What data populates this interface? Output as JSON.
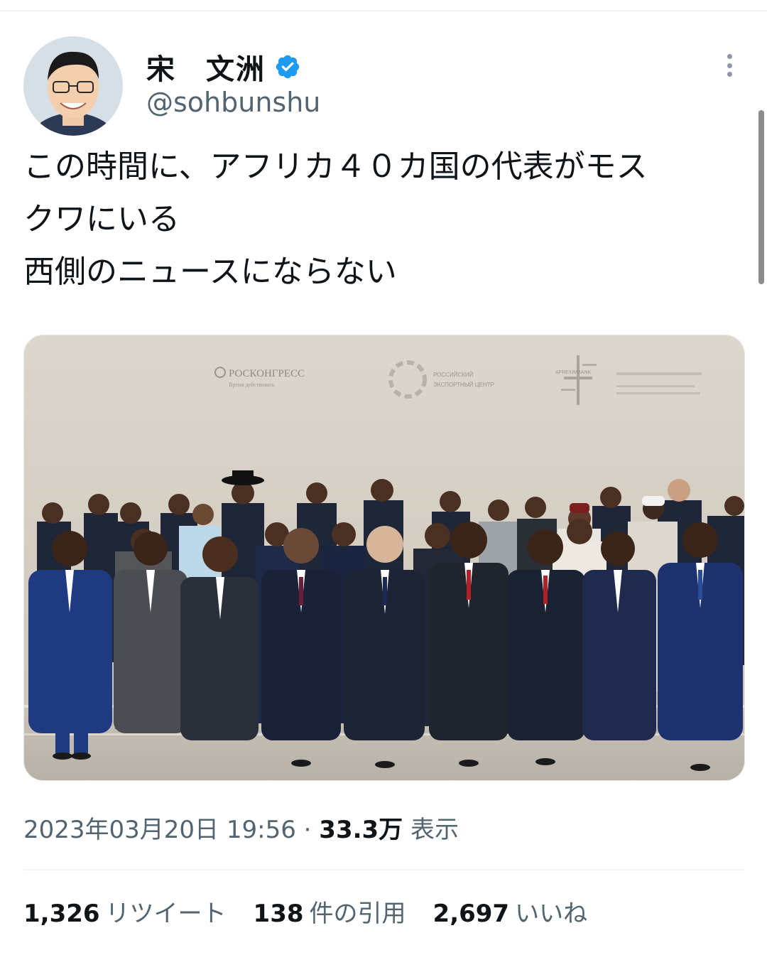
{
  "author": {
    "name": "宋　文洲",
    "handle": "@sohbunshu"
  },
  "tweet": {
    "lines": [
      "この時間に、アフリカ４０カ国の代表がモス",
      "クワにいる",
      "西側のニュースにならない"
    ]
  },
  "photo_signage": {
    "roscongress": "РОСКОНГРЕСС",
    "roscongress_sub": "Время действовать",
    "rec_line1": "РОССИЙСКИЙ",
    "rec_line2": "ЭКСПОРТНЫЙ ЦЕНТР",
    "afrex": "AFREXIMBANK"
  },
  "meta": {
    "datetime": "2023年03月20日 19:56",
    "separator": "·",
    "views": "33.3万",
    "views_label": "表示"
  },
  "stats": {
    "retweets": "1,326",
    "retweets_label": "リツイート",
    "quotes": "138",
    "quotes_label": "件の引用",
    "likes": "2,697",
    "likes_label": "いいね"
  },
  "colors": {
    "verified": "#1d9bf0",
    "secondary_text": "#536471",
    "wall": "#d9d3c8"
  },
  "icons": [
    "verified-badge-icon",
    "more-options-icon"
  ]
}
